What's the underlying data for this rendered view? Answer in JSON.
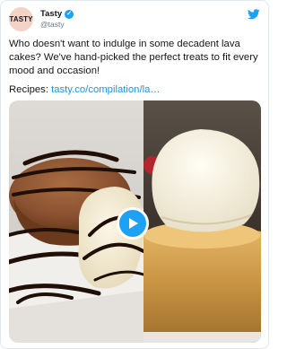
{
  "account": {
    "avatar_text": "TASTY",
    "display_name": "Tasty",
    "handle": "@tasty",
    "verified": true
  },
  "tweet": {
    "text": "Who doesn't want to indulge in some decadent lava cakes? We've hand-picked the perfect treats to fit every mood and occasion!",
    "recipes_prefix": "Recipes: ",
    "link_text": "tasty.co/compilation/la…"
  },
  "media": {
    "type": "video",
    "play_icon": "play-icon"
  },
  "colors": {
    "brand_blue": "#1da1f2",
    "link": "#1b95e0",
    "text": "#14171a",
    "muted": "#657786"
  },
  "icons": {
    "brand": "twitter-bird-icon",
    "verified": "verified-badge-icon"
  }
}
